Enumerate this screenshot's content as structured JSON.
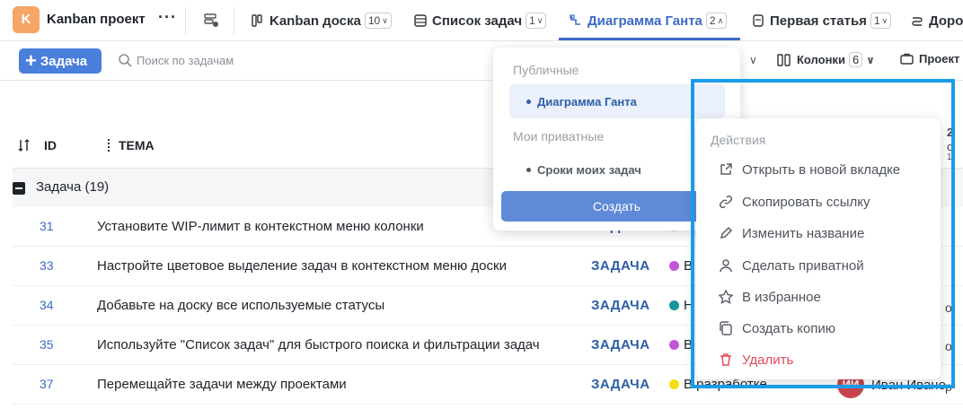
{
  "project": {
    "avatar_letter": "K",
    "name": "Kanban проект",
    "more": "···"
  },
  "tabs": [
    {
      "label": "Kanban доска",
      "count": "10"
    },
    {
      "label": "Список задач",
      "count": "1"
    },
    {
      "label": "Диаграмма Ганта",
      "count": "2"
    },
    {
      "label": "Первая статья",
      "count": "1"
    },
    {
      "label": "Доро"
    }
  ],
  "toolbar": {
    "add_task_label": "Задача",
    "search_placeholder": "Поиск по задачам",
    "columns_label": "Колонки",
    "columns_count": "6",
    "project_label": "Проект"
  },
  "table": {
    "headers": {
      "id": "ID",
      "topic": "ТЕМА"
    },
    "group": {
      "label": "Задача (19)"
    },
    "rows": [
      {
        "id": "31",
        "topic": "Установите WIP-лимит в контекстном меню колонки",
        "type": "ЗАДАЧА",
        "status": "",
        "dot": "#cfd2d6"
      },
      {
        "id": "33",
        "topic": "Настройте цветовое выделение задач в контекстном меню доски",
        "type": "ЗАДАЧА",
        "status": "В",
        "dot": "#c354d8"
      },
      {
        "id": "34",
        "topic": "Добавьте на доску все используемые статусы",
        "type": "ЗАДАЧА",
        "status": "Н",
        "dot": "#12959b"
      },
      {
        "id": "35",
        "topic": "Используйте \"Список задач\" для быстрого поиска и фильтрации задач",
        "type": "ЗАДАЧА",
        "status": "В",
        "dot": "#c354d8"
      },
      {
        "id": "37",
        "topic": "Перемещайте задачи между проектами",
        "type": "ЗАДАЧА",
        "status": "В разработке",
        "dot": "#f2e012"
      }
    ],
    "assignee": {
      "initials": "ИИ",
      "name": "Иван Ивано"
    },
    "side_fragments": [
      "2",
      "с",
      "1",
      "о",
      "о",
      "р"
    ]
  },
  "views_dropdown": {
    "public_label": "Публичные",
    "public_items": [
      "Диаграмма Ганта"
    ],
    "private_label": "Мои приватные",
    "private_items": [
      "Сроки моих задач"
    ],
    "create_label": "Создать"
  },
  "actions_menu": {
    "title": "Действия",
    "items": [
      {
        "label": "Открыть в новой вкладке",
        "icon": "external-link-icon"
      },
      {
        "label": "Скопировать ссылку",
        "icon": "link-icon"
      },
      {
        "label": "Изменить название",
        "icon": "pencil-icon"
      },
      {
        "label": "Сделать приватной",
        "icon": "user-icon"
      },
      {
        "label": "В избранное",
        "icon": "star-icon"
      },
      {
        "label": "Создать копию",
        "icon": "copy-icon"
      },
      {
        "label": "Удалить",
        "icon": "trash-icon"
      }
    ]
  },
  "colors": {
    "accent": "#3d6ac6",
    "primary_button": "#4a7fdb",
    "danger": "#e04a55",
    "highlight": "#1a9be8"
  }
}
